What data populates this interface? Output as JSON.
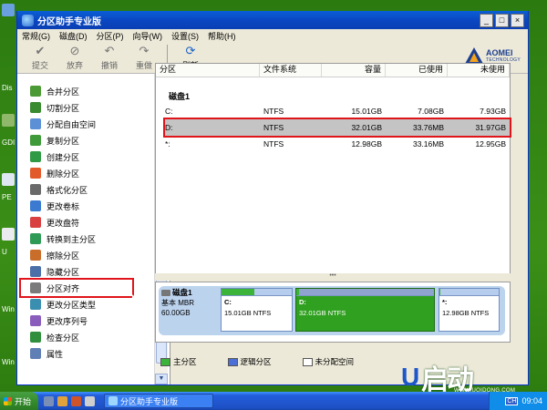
{
  "window": {
    "title": "分区助手专业版",
    "controls": {
      "minimize": "_",
      "maximize": "□",
      "close": "×"
    }
  },
  "desktop": {
    "labels": [
      "Dis",
      "GDI",
      "PE",
      "U",
      "Win",
      "Win"
    ]
  },
  "menu": [
    "常规(G)",
    "磁盘(D)",
    "分区(P)",
    "向导(W)",
    "设置(S)",
    "帮助(H)"
  ],
  "toolbar": {
    "buttons": [
      {
        "label": "提交",
        "icon": "check-icon"
      },
      {
        "label": "放弃",
        "icon": "discard-icon"
      },
      {
        "label": "撤销",
        "icon": "undo-icon"
      },
      {
        "label": "重做",
        "icon": "redo-icon"
      },
      {
        "label": "刷新",
        "icon": "refresh-icon"
      }
    ],
    "brand": {
      "name": "AOMEI",
      "sub": "TECHNOLOGY"
    }
  },
  "operations": [
    {
      "label": "合并分区",
      "color": "#4c9a36"
    },
    {
      "label": "切割分区",
      "color": "#3a8a2f"
    },
    {
      "label": "分配自由空间",
      "color": "#5b8fd6"
    },
    {
      "label": "复制分区",
      "color": "#3f9a39"
    },
    {
      "label": "创建分区",
      "color": "#2f9a46"
    },
    {
      "label": "删除分区",
      "color": "#e25a2a"
    },
    {
      "label": "格式化分区",
      "color": "#6a6a6a"
    },
    {
      "label": "更改卷标",
      "color": "#3a7ad0"
    },
    {
      "label": "更改盘符",
      "color": "#d94040"
    },
    {
      "label": "转换到主分区",
      "color": "#2e9a55"
    },
    {
      "label": "擦除分区",
      "color": "#c96d2a"
    },
    {
      "label": "隐藏分区",
      "color": "#4b6fa8"
    },
    {
      "label": "分区对齐",
      "color": "#7b7b7b"
    },
    {
      "label": "更改分区类型",
      "color": "#3a8fb0"
    },
    {
      "label": "更改序列号",
      "color": "#8a5dbd"
    },
    {
      "label": "检查分区",
      "color": "#2f8f3c"
    },
    {
      "label": "属性",
      "color": "#5f7fb5"
    }
  ],
  "selected_operation": "分区对齐",
  "table": {
    "headers": [
      "分区",
      "文件系统",
      "容量",
      "已使用",
      "未使用"
    ],
    "disk_title": "磁盘1",
    "rows": [
      {
        "partition": "C:",
        "fs": "NTFS",
        "capacity": "15.01GB",
        "used": "7.08GB",
        "free": "7.93GB",
        "selected": false
      },
      {
        "partition": "D:",
        "fs": "NTFS",
        "capacity": "32.01GB",
        "used": "33.76MB",
        "free": "31.97GB",
        "selected": true
      },
      {
        "partition": "*:",
        "fs": "NTFS",
        "capacity": "12.98GB",
        "used": "33.16MB",
        "free": "12.95GB",
        "selected": false
      }
    ]
  },
  "disk_map": {
    "name": "磁盘1",
    "type": "基本 MBR",
    "size": "60.00GB",
    "parts": [
      {
        "name": "C:",
        "desc": "15.01GB NTFS",
        "used_fraction": 0.47
      },
      {
        "name": "D:",
        "desc": "32.01GB NTFS",
        "used_fraction": 0.01
      },
      {
        "name": "*:",
        "desc": "12.98GB NTFS",
        "used_fraction": 0.01
      }
    ]
  },
  "legend": [
    {
      "label": "主分区",
      "color": "#3cb43a"
    },
    {
      "label": "逻辑分区",
      "color": "#4b6fd6"
    },
    {
      "label": "未分配空间",
      "color": "#ffffff"
    }
  ],
  "taskbar": {
    "start": "开始",
    "task": "分区助手专业版",
    "ime": "CH",
    "time": "09:04"
  },
  "watermark": {
    "text": "启动",
    "url": "WWW.UQIDONG.COM"
  }
}
